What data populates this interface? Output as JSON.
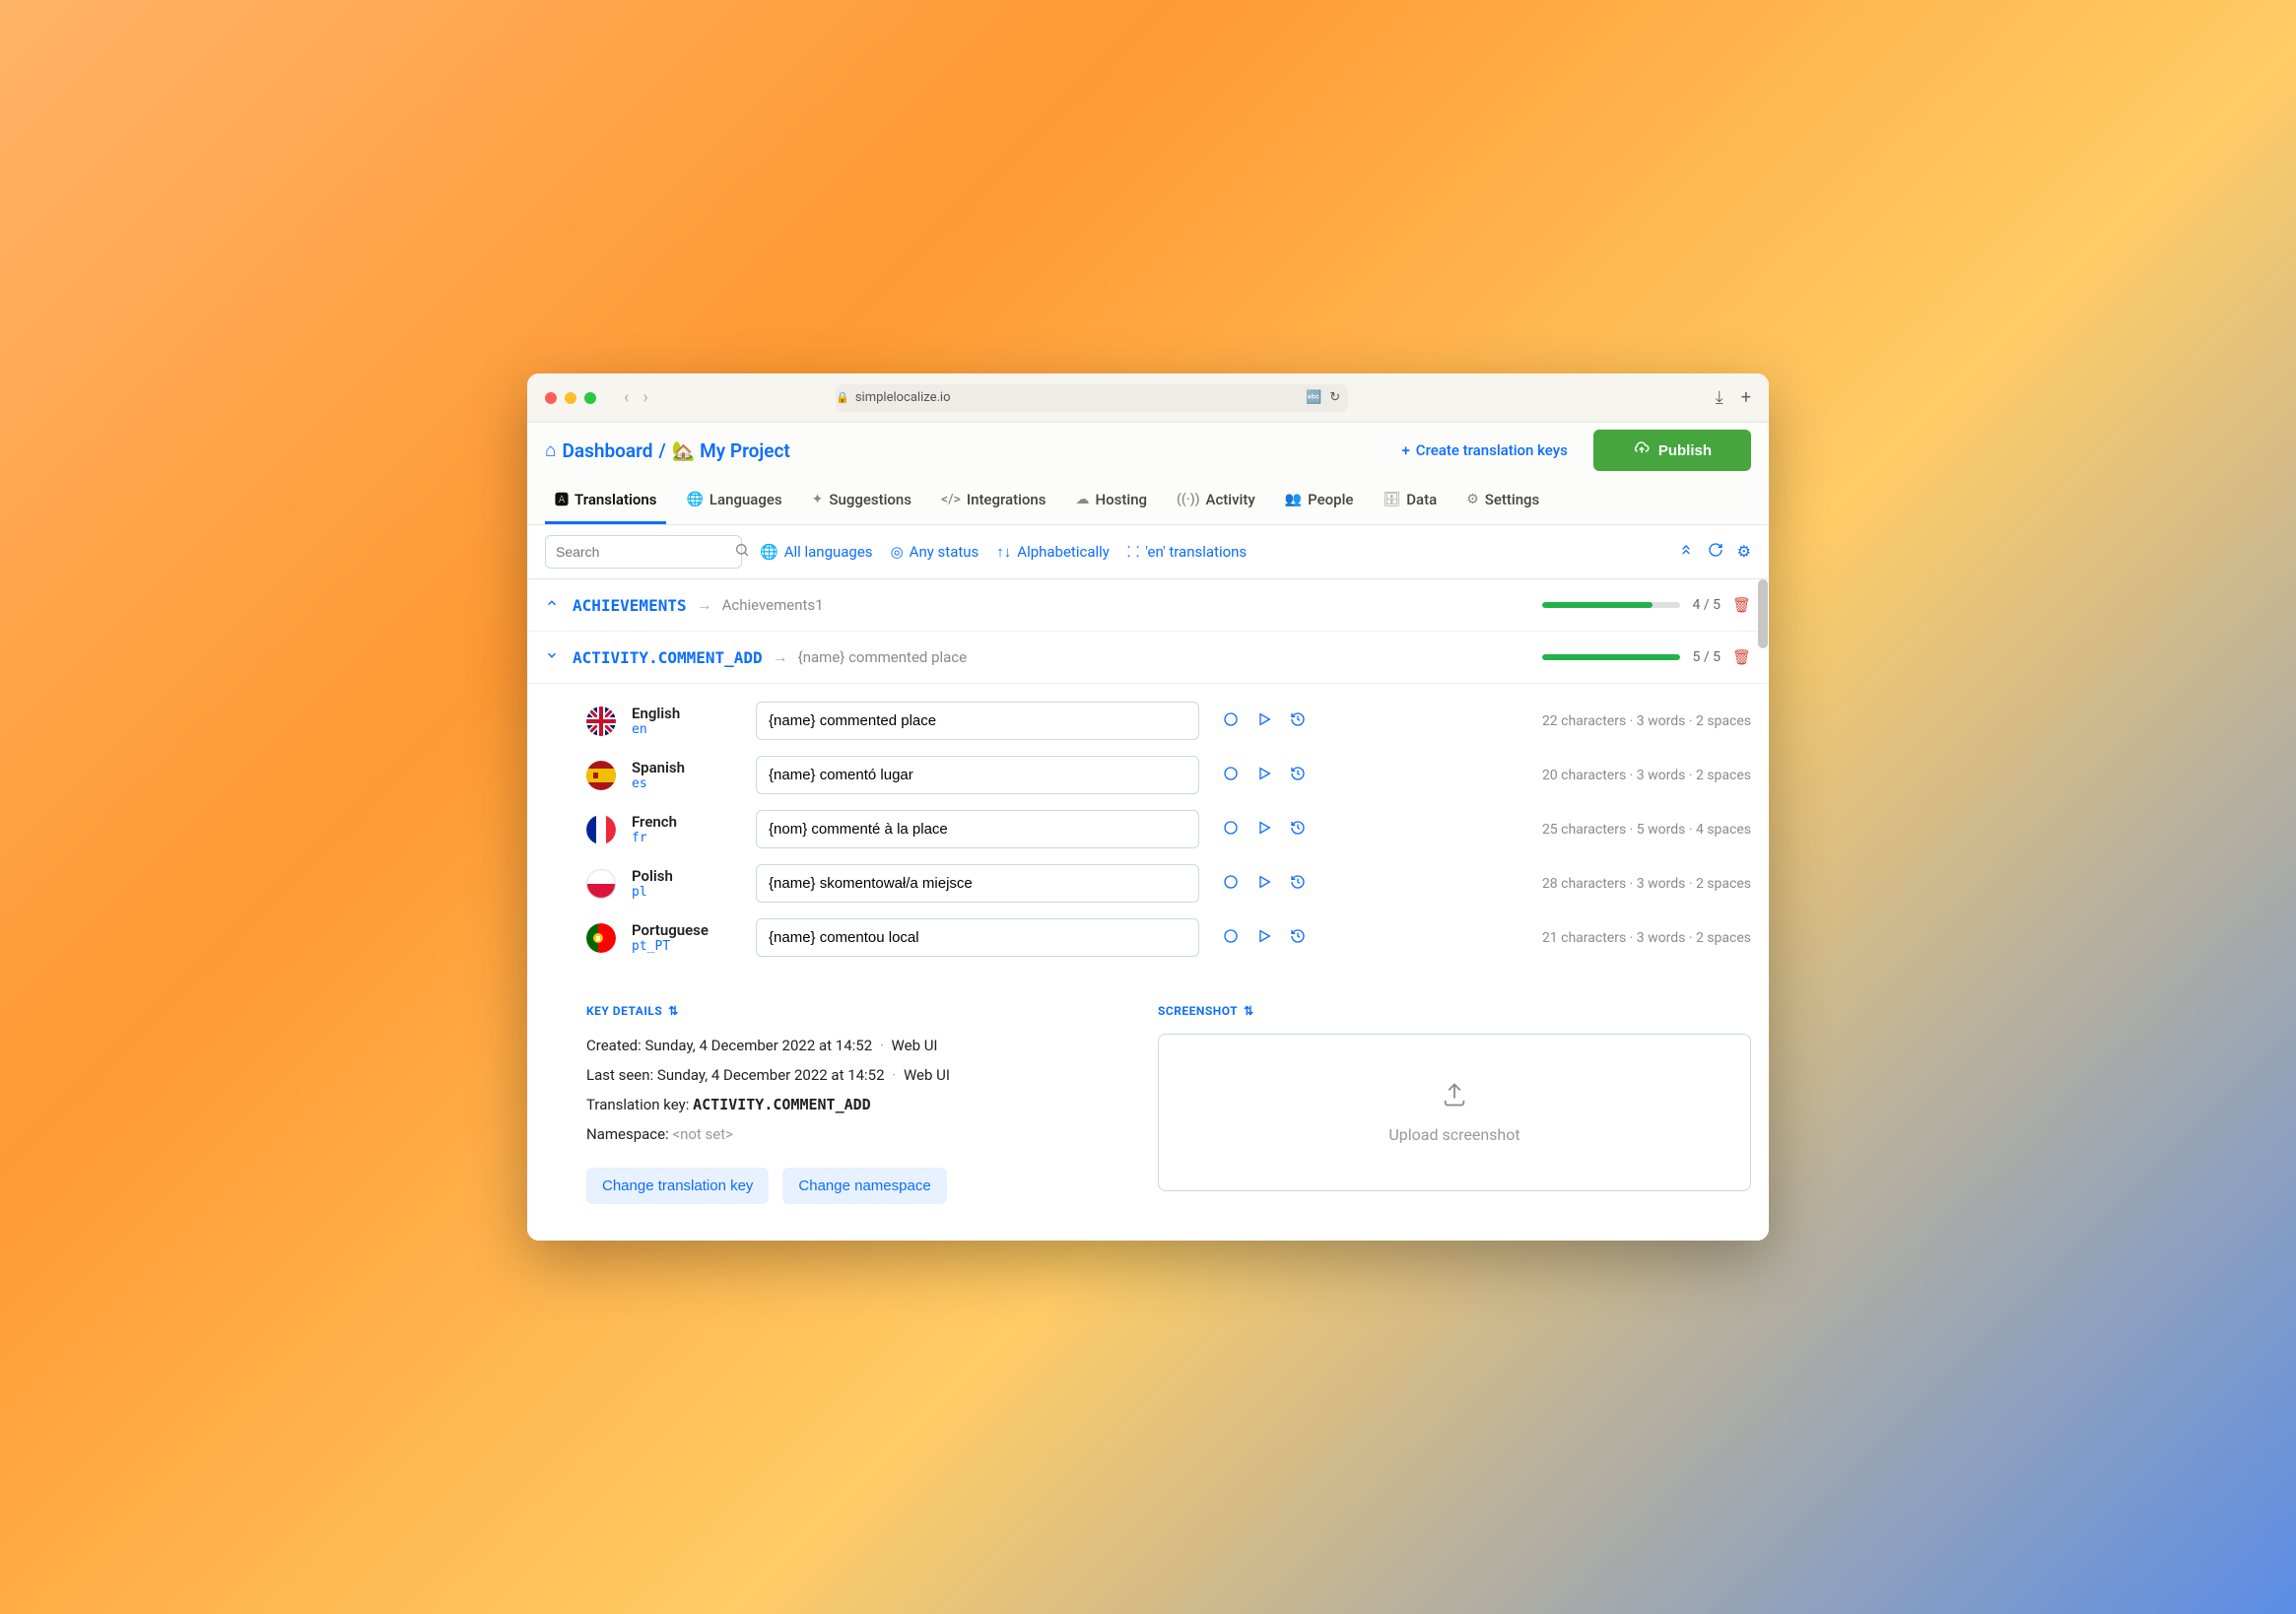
{
  "window": {
    "url": "simplelocalize.io"
  },
  "breadcrumb": {
    "dashboard": "Dashboard",
    "project_prefix": "🏡",
    "project": "My Project"
  },
  "header_actions": {
    "create_keys": "Create translation keys",
    "publish": "Publish"
  },
  "tabs": [
    {
      "label": "Translations",
      "active": true
    },
    {
      "label": "Languages"
    },
    {
      "label": "Suggestions"
    },
    {
      "label": "Integrations"
    },
    {
      "label": "Hosting"
    },
    {
      "label": "Activity"
    },
    {
      "label": "People"
    },
    {
      "label": "Data"
    },
    {
      "label": "Settings"
    }
  ],
  "search": {
    "placeholder": "Search"
  },
  "filters": {
    "languages": "All languages",
    "status": "Any status",
    "sort": "Alphabetically",
    "view": "'en' translations"
  },
  "keys": [
    {
      "name": "ACHIEVEMENTS",
      "preview": "Achievements1",
      "progress": "4 / 5",
      "progress_pct": 80,
      "expanded": false
    },
    {
      "name": "ACTIVITY.COMMENT_ADD",
      "preview": "{name} commented place",
      "progress": "5 / 5",
      "progress_pct": 100,
      "expanded": true
    }
  ],
  "translations": [
    {
      "lang": "English",
      "code": "en",
      "value": "{name} commented place",
      "stats": "22 characters  ·  3 words  ·  2 spaces"
    },
    {
      "lang": "Spanish",
      "code": "es",
      "value": "{name} comentó lugar",
      "stats": "20 characters  ·  3 words  ·  2 spaces"
    },
    {
      "lang": "French",
      "code": "fr",
      "value": "{nom} commenté à la place",
      "stats": "25 characters  ·  5 words  ·  4 spaces"
    },
    {
      "lang": "Polish",
      "code": "pl",
      "value": "{name} skomentował/a miejsce",
      "stats": "28 characters  ·  3 words  ·  2 spaces"
    },
    {
      "lang": "Portuguese",
      "code": "pt_PT",
      "value": "{name} comentou local",
      "stats": "21 characters  ·  3 words  ·  2 spaces"
    }
  ],
  "key_details": {
    "title": "KEY DETAILS",
    "created_label": "Created:",
    "created_value": "Sunday, 4 December 2022 at 14:52",
    "created_source": "Web UI",
    "lastseen_label": "Last seen:",
    "lastseen_value": "Sunday, 4 December 2022 at 14:52",
    "lastseen_source": "Web UI",
    "tkey_label": "Translation key:",
    "tkey_value": "ACTIVITY.COMMENT_ADD",
    "ns_label": "Namespace:",
    "ns_value": "<not set>",
    "change_key": "Change translation key",
    "change_ns": "Change namespace"
  },
  "screenshot_section": {
    "title": "SCREENSHOT",
    "upload": "Upload screenshot"
  }
}
